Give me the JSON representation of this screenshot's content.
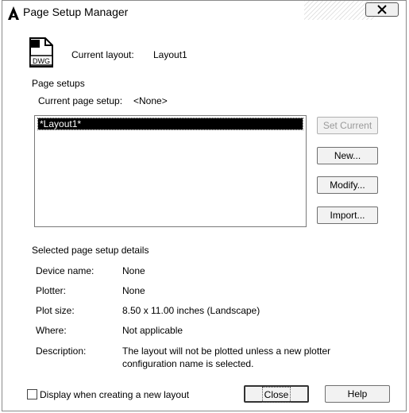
{
  "window": {
    "title": "Page Setup Manager",
    "close_glyph": "✕"
  },
  "current_layout": {
    "label": "Current layout:",
    "value": "Layout1"
  },
  "page_setups": {
    "group_label": "Page setups",
    "current_label": "Current page setup:",
    "current_value": "<None>",
    "items": [
      {
        "label": "*Layout1*",
        "selected": true
      }
    ]
  },
  "buttons": {
    "set_current": "Set Current",
    "new": "New...",
    "modify": "Modify...",
    "import": "Import...",
    "close": "Close",
    "help": "Help"
  },
  "details": {
    "group_label": "Selected page setup details",
    "rows": [
      {
        "label": "Device name:",
        "value": "None"
      },
      {
        "label": "Plotter:",
        "value": "None"
      },
      {
        "label": "Plot size:",
        "value": "8.50 x 11.00 inches (Landscape)"
      },
      {
        "label": "Where:",
        "value": "Not applicable"
      },
      {
        "label": "Description:",
        "value": "The layout will not be plotted unless a new plotter",
        "value2": "configuration name is selected."
      }
    ]
  },
  "display_checkbox": {
    "label": "Display when creating a new layout",
    "checked": false
  },
  "icons": {
    "app": "autocad-a-icon",
    "file": "dwg-file-icon"
  }
}
